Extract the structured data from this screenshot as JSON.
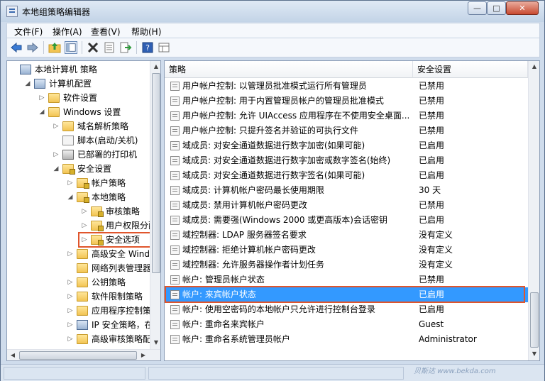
{
  "window": {
    "title": "本地组策略编辑器",
    "min": "—",
    "max": "□",
    "close": "✕"
  },
  "menu": [
    "文件(F)",
    "操作(A)",
    "查看(V)",
    "帮助(H)"
  ],
  "toolbar_icons": [
    "back-arrow-icon",
    "forward-arrow-icon",
    "up-folder-icon",
    "show-tree-icon",
    "delete-icon",
    "properties-icon",
    "export-icon",
    "help-icon",
    "view-icon"
  ],
  "tree": [
    {
      "label": "本地计算机 策略",
      "icon": "computer",
      "exp": "",
      "indent": 0
    },
    {
      "label": "计算机配置",
      "icon": "computer",
      "exp": "◢",
      "indent": 1
    },
    {
      "label": "软件设置",
      "icon": "folder",
      "exp": "▷",
      "indent": 2
    },
    {
      "label": "Windows 设置",
      "icon": "folder",
      "exp": "◢",
      "indent": 2
    },
    {
      "label": "域名解析策略",
      "icon": "folder",
      "exp": "▷",
      "indent": 3
    },
    {
      "label": "脚本(启动/关机)",
      "icon": "doc",
      "exp": "",
      "indent": 3
    },
    {
      "label": "已部署的打印机",
      "icon": "printer",
      "exp": "▷",
      "indent": 3
    },
    {
      "label": "安全设置",
      "icon": "folder-lock",
      "exp": "◢",
      "indent": 3
    },
    {
      "label": "帐户策略",
      "icon": "folder-lock",
      "exp": "▷",
      "indent": 4
    },
    {
      "label": "本地策略",
      "icon": "folder-lock",
      "exp": "◢",
      "indent": 4
    },
    {
      "label": "审核策略",
      "icon": "folder-lock",
      "exp": "▷",
      "indent": 5
    },
    {
      "label": "用户权限分配",
      "icon": "folder-lock",
      "exp": "▷",
      "indent": 5
    },
    {
      "label": "安全选项",
      "icon": "folder-lock",
      "exp": "▷",
      "indent": 5,
      "selected": true
    },
    {
      "label": "高级安全 Window",
      "icon": "folder",
      "exp": "▷",
      "indent": 4
    },
    {
      "label": "网络列表管理器策",
      "icon": "folder",
      "exp": "",
      "indent": 4
    },
    {
      "label": "公钥策略",
      "icon": "folder",
      "exp": "▷",
      "indent": 4
    },
    {
      "label": "软件限制策略",
      "icon": "folder",
      "exp": "▷",
      "indent": 4
    },
    {
      "label": "应用程序控制策略",
      "icon": "folder",
      "exp": "▷",
      "indent": 4
    },
    {
      "label": "IP 安全策略，在 本",
      "icon": "computer",
      "exp": "▷",
      "indent": 4
    },
    {
      "label": "高级审核策略配置",
      "icon": "folder",
      "exp": "▷",
      "indent": 4
    }
  ],
  "columns": {
    "policy": "策略",
    "setting": "安全设置"
  },
  "rows": [
    {
      "policy": "用户帐户控制: 以管理员批准模式运行所有管理员",
      "setting": "已禁用"
    },
    {
      "policy": "用户帐户控制: 用于内置管理员帐户的管理员批准模式",
      "setting": "已禁用"
    },
    {
      "policy": "用户帐户控制: 允许 UIAccess 应用程序在不使用安全桌面...",
      "setting": "已禁用"
    },
    {
      "policy": "用户帐户控制: 只提升签名并验证的可执行文件",
      "setting": "已禁用"
    },
    {
      "policy": "域成员: 对安全通道数据进行数字加密(如果可能)",
      "setting": "已启用"
    },
    {
      "policy": "域成员: 对安全通道数据进行数字加密或数字签名(始终)",
      "setting": "已启用"
    },
    {
      "policy": "域成员: 对安全通道数据进行数字签名(如果可能)",
      "setting": "已启用"
    },
    {
      "policy": "域成员: 计算机帐户密码最长使用期限",
      "setting": "30 天"
    },
    {
      "policy": "域成员: 禁用计算机帐户密码更改",
      "setting": "已禁用"
    },
    {
      "policy": "域成员: 需要强(Windows 2000 或更高版本)会话密钥",
      "setting": "已启用"
    },
    {
      "policy": "域控制器: LDAP 服务器签名要求",
      "setting": "没有定义"
    },
    {
      "policy": "域控制器: 拒绝计算机帐户密码更改",
      "setting": "没有定义"
    },
    {
      "policy": "域控制器: 允许服务器操作者计划任务",
      "setting": "没有定义"
    },
    {
      "policy": "帐户: 管理员帐户状态",
      "setting": "已禁用"
    },
    {
      "policy": "帐户: 来宾帐户状态",
      "setting": "已启用",
      "selected": true
    },
    {
      "policy": "帐户: 使用空密码的本地帐户只允许进行控制台登录",
      "setting": "已启用"
    },
    {
      "policy": "帐户: 重命名来宾帐户",
      "setting": "Guest"
    },
    {
      "policy": "帐户: 重命名系统管理员帐户",
      "setting": "Administrator"
    }
  ],
  "watermark": "贝斯达 www.bekda.com"
}
